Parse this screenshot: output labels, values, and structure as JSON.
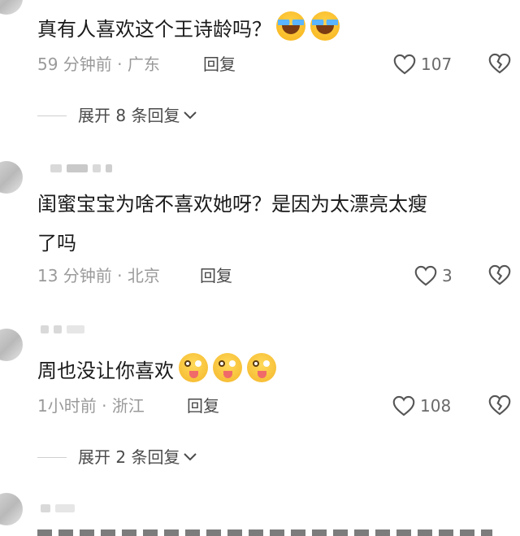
{
  "comments": [
    {
      "text": "真有人喜欢这个王诗龄吗？",
      "emojis": [
        "laugh-emoji",
        "laugh-emoji"
      ],
      "time": "59 分钟前 · 广东",
      "reply_label": "回复",
      "likes": "107",
      "expand": "展开 8 条回复"
    },
    {
      "text_line1": "闺蜜宝宝为啥不喜欢她呀？是因为太漂亮太瘦",
      "text_line2": "了吗",
      "time": "13 分钟前 · 北京",
      "reply_label": "回复",
      "likes": "3"
    },
    {
      "text": "周也没让你喜欢",
      "emojis": [
        "tongue-emoji",
        "tongue-emoji",
        "tongue-emoji"
      ],
      "time": "1小时前 · 浙江",
      "reply_label": "回复",
      "likes": "108",
      "expand": "展开 2 条回复"
    }
  ],
  "colors": {
    "text": "#1a1a1a",
    "meta": "#9a9a9a",
    "icon": "#555555"
  }
}
